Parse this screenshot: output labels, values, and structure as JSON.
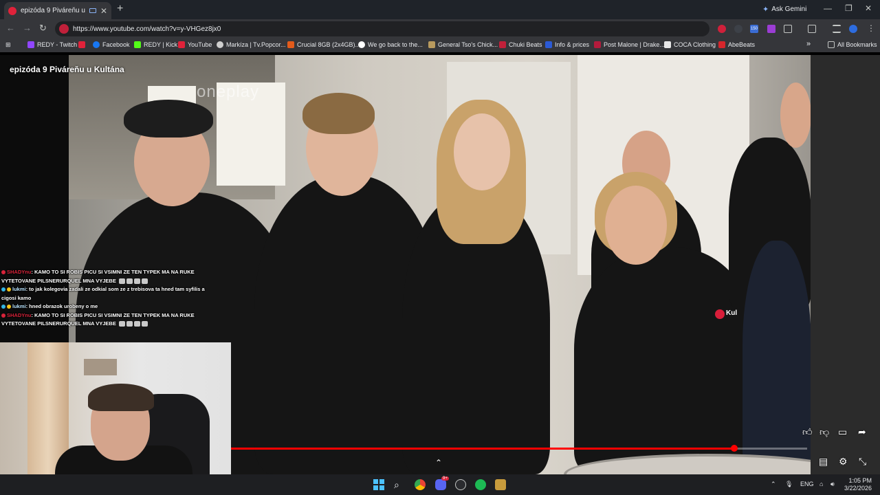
{
  "browser": {
    "tab_title": "epizóda 9 Piváreňu u Kultána",
    "tab_close": "✕",
    "new_tab": "+",
    "ask_gemini": "Ask Gemini",
    "url": "https://www.youtube.com/watch?v=y-VHGez8jx0",
    "extension_badge": "150"
  },
  "bookmarks": [
    {
      "label": "REDY - Twitch",
      "color": "#9146ff"
    },
    {
      "label": "",
      "color": "#e0223a"
    },
    {
      "label": "Facebook",
      "color": "#1877f2"
    },
    {
      "label": "REDY | Kick",
      "color": "#53fc18"
    },
    {
      "label": "YouTube",
      "color": "#e0223a"
    },
    {
      "label": "Markíza | Tv.Popcor...",
      "color": "#cfcfcf"
    },
    {
      "label": "Crucial 8GB (2x4GB)...",
      "color": "#e25b1b"
    },
    {
      "label": "We go back to the...",
      "color": "#ffffff"
    },
    {
      "label": "General Tso's Chick...",
      "color": "#b89a5e"
    },
    {
      "label": "Chuki Beats",
      "color": "#c0203a"
    },
    {
      "label": "Info & prices",
      "color": "#2b5ad6"
    },
    {
      "label": "Post Malone | Drake...",
      "color": "#b31b3c"
    },
    {
      "label": "COCA Clothing",
      "color": "#e8e8e8"
    },
    {
      "label": "AbeBeats",
      "color": "#d6262c"
    }
  ],
  "bookmarks_more": "»",
  "all_bookmarks": "All Bookmarks",
  "video": {
    "title": "epizóda 9 Piváreňu u Kultána",
    "watermark": "oneplay",
    "apron_logo": "Kul",
    "progress": 0.873
  },
  "chat": [
    {
      "user": "SHADYnu",
      "user_color": "#d9233a",
      "badge_color": "#d9233a",
      "text": ": KAMO TO SI ROBIS PICU SI VSIMNI ZE TEN TYPEK MA NA RUKE VYTETOVANE PILSNERURQUEL MNA VYJEBE",
      "emotes": 4
    },
    {
      "user": "lukmi",
      "user_color": "#b9e4ff",
      "badge_color": "#33b5e5",
      "text": ": to jak kolegovia zadali ze odkial som ze z trebisova ta hned tam syfilis a cigosi kamo",
      "emotes": 0
    },
    {
      "user": "lukmi",
      "user_color": "#b9e4ff",
      "badge_color": "#33b5e5",
      "text": ": hned obrazok urobeny o me",
      "emotes": 0
    },
    {
      "user": "SHADYnu",
      "user_color": "#d9233a",
      "badge_color": "#d9233a",
      "text": ": KAMO TO SI ROBIS PICU SI VSIMNI ZE TEN TYPEK MA NA RUKE VYTETOVANE PILSNERURQUEL MNA VYJEBE",
      "emotes": 4
    }
  ],
  "taskbar": {
    "lang": "ENG",
    "time": "1:05 PM",
    "date": "3/22/2026",
    "discord_badge": "9+"
  }
}
